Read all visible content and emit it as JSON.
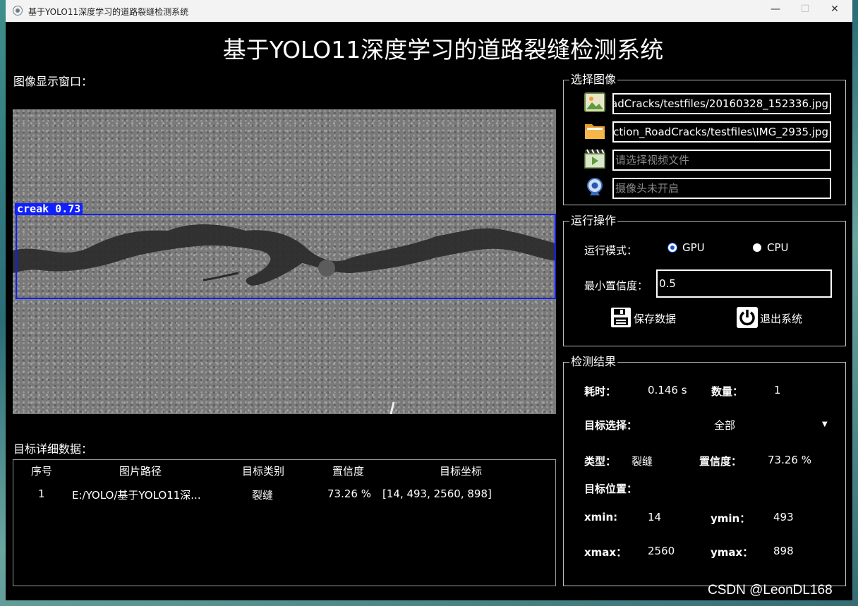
{
  "window": {
    "title": "基于YOLO11深度学习的道路裂缝检测系统",
    "minimize": "—",
    "maximize": "☐",
    "close": "✕"
  },
  "header": {
    "title": "基于YOLO11深度学习的道路裂缝检测系统"
  },
  "image_panel": {
    "label": "图像显示窗口：",
    "detection_label": "creak 0.73",
    "detection_color": "#1020ff"
  },
  "details": {
    "label": "目标详细数据：",
    "columns": [
      "序号",
      "图片路径",
      "目标类别",
      "置信度",
      "目标坐标"
    ],
    "rows": [
      [
        "1",
        "E:/YOLO/基于YOLO11深...",
        "裂缝",
        "73.26 %",
        "[14, 493, 2560, 898]"
      ]
    ]
  },
  "select_image": {
    "title": "选择图像",
    "image_path": "oadCracks/testfiles/20160328_152336.jpg",
    "folder_path": "ction_RoadCracks/testfiles\\IMG_2935.jpg",
    "video_placeholder": "请选择视频文件",
    "camera_placeholder": "摄像头未开启",
    "icons": [
      "image-icon",
      "folder-icon",
      "video-icon",
      "camera-icon"
    ]
  },
  "operation": {
    "title": "运行操作",
    "mode_label": "运行模式：",
    "gpu_label": "GPU",
    "cpu_label": "CPU",
    "selected_mode": "GPU",
    "conf_label": "最小置信度：",
    "conf_value": "0.5",
    "save_label": "保存数据",
    "exit_label": "退出系统"
  },
  "results": {
    "title": "检测结果",
    "time_label": "耗时：",
    "time_value": "0.146 s",
    "count_label": "数量：",
    "count_value": "1",
    "target_select_label": "目标选择：",
    "target_select_value": "全部",
    "type_label": "类型：",
    "type_value": "裂缝",
    "conf_label": "置信度：",
    "conf_value": "73.26 %",
    "position_label": "目标位置：",
    "xmin_label": "xmin:",
    "xmin_value": "14",
    "ymin_label": "ymin：",
    "ymin_value": "493",
    "xmax_label": "xmax：",
    "xmax_value": "2560",
    "ymax_label": "ymax：",
    "ymax_value": "898"
  },
  "watermark": "CSDN @LeonDL168"
}
